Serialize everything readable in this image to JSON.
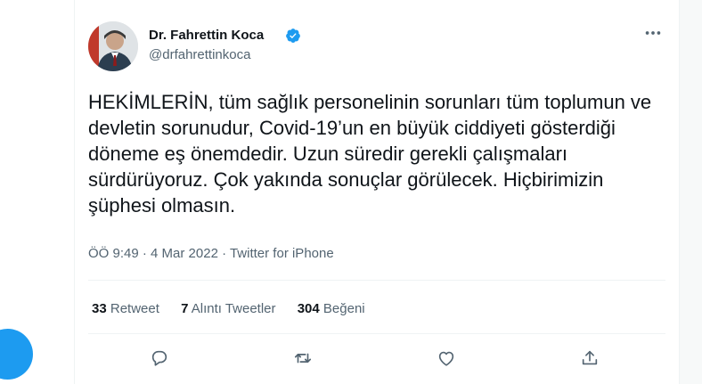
{
  "author": {
    "name": "Dr. Fahrettin Koca",
    "handle": "@drfahrettinkoca",
    "verified": true
  },
  "tweet": {
    "text": "HEKİMLERİN, tüm sağlık personelinin sorunları tüm toplumun ve devletin sorunudur, Covid-19’un en büyük ciddiyeti gösterdiği döneme eş önemdedir. Uzun süredir gerekli çalışmaları sürdürüyoruz. Çok yakında sonuçlar görülecek. Hiçbirimizin şüphesi olmasın.",
    "meta": "ÖÖ 9:49 · 4 Mar 2022 · Twitter for iPhone"
  },
  "stats": {
    "retweets": {
      "count": "33",
      "label": "Retweet"
    },
    "quotes": {
      "count": "7",
      "label": "Alıntı Tweetler"
    },
    "likes": {
      "count": "304",
      "label": "Beğeni"
    }
  },
  "icons": {
    "more": "more-icon",
    "reply": "reply-icon",
    "retweet": "retweet-icon",
    "like": "heart-icon",
    "share": "share-icon",
    "verified": "verified-badge-icon"
  },
  "colors": {
    "accent": "#1d9bf0",
    "text": "#0f1419",
    "secondary": "#536471"
  }
}
